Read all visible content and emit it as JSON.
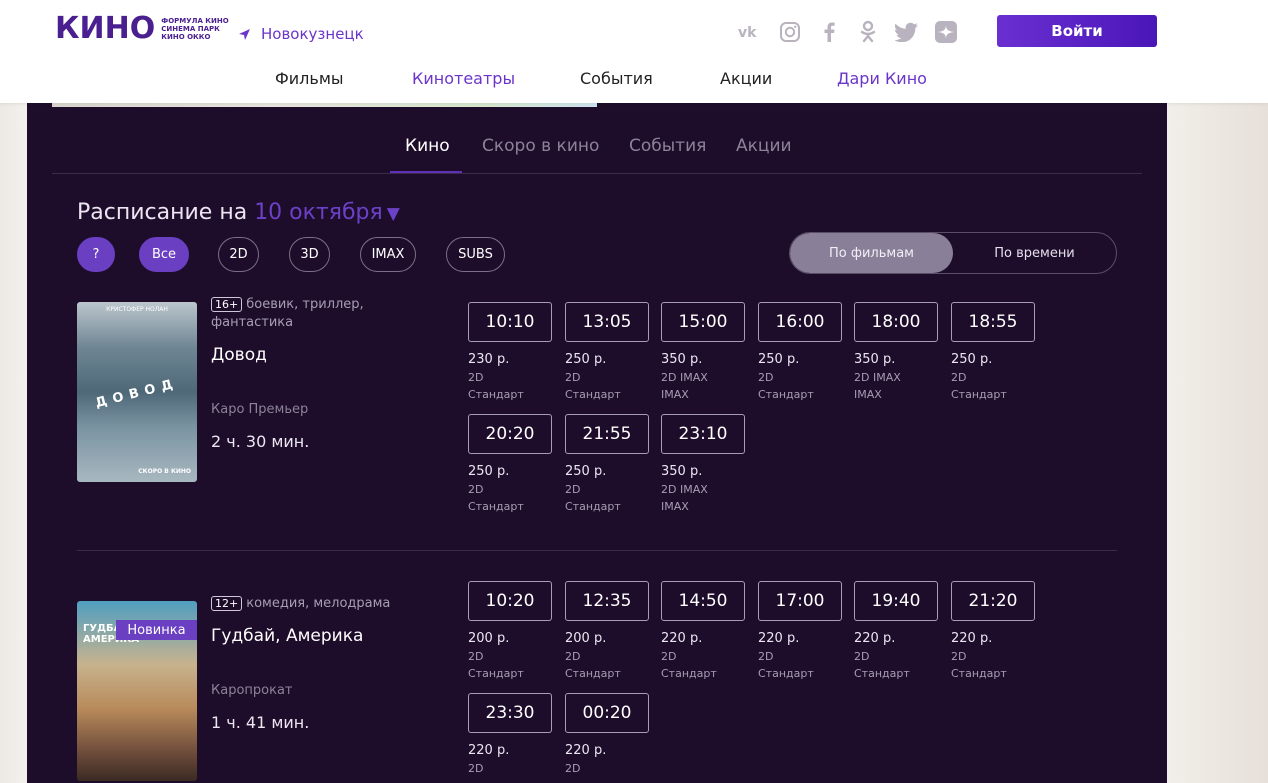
{
  "header": {
    "logo_text": "КИНО",
    "logo_sub": [
      "ФОРМУЛА КИНО",
      "СИНЕМА ПАРК",
      "КИНО ОККО"
    ],
    "city": "Новокузнецк",
    "login_label": "Войти",
    "socials": [
      "vk-icon",
      "instagram-icon",
      "facebook-icon",
      "odnoklassniki-icon",
      "twitter-icon",
      "zen-icon"
    ],
    "nav": [
      "Фильмы",
      "Кинотеатры",
      "События",
      "Акции",
      "Дари Кино"
    ]
  },
  "tabs": [
    "Кино",
    "Скоро в кино",
    "События",
    "Акции"
  ],
  "schedule": {
    "title_prefix": "Расписание на",
    "date": "10 октября",
    "filters": [
      "?",
      "Все",
      "2D",
      "3D",
      "IMAX",
      "SUBS"
    ],
    "view_toggle": [
      "По фильмам",
      "По времени"
    ]
  },
  "movies": [
    {
      "age": "16+",
      "genres": "боевик, триллер, фантастика",
      "title": "Довод",
      "distributor": "Каро Премьер",
      "duration": "2 ч. 30 мин.",
      "poster_top": "КРИСТОФЕР НОЛАН",
      "poster_title": "ДОВОД",
      "poster_bottom": "СКОРО В КИНО",
      "sessions": [
        {
          "time": "10:10",
          "price": "230 р.",
          "format": "2D",
          "hall": "Стандарт"
        },
        {
          "time": "13:05",
          "price": "250 р.",
          "format": "2D",
          "hall": "Стандарт"
        },
        {
          "time": "15:00",
          "price": "350 р.",
          "format": "2D IMAX",
          "hall": "IMAX"
        },
        {
          "time": "16:00",
          "price": "250 р.",
          "format": "2D",
          "hall": "Стандарт"
        },
        {
          "time": "18:00",
          "price": "350 р.",
          "format": "2D IMAX",
          "hall": "IMAX"
        },
        {
          "time": "18:55",
          "price": "250 р.",
          "format": "2D",
          "hall": "Стандарт"
        },
        {
          "time": "20:20",
          "price": "250 р.",
          "format": "2D",
          "hall": "Стандарт"
        },
        {
          "time": "21:55",
          "price": "250 р.",
          "format": "2D",
          "hall": "Стандарт"
        },
        {
          "time": "23:10",
          "price": "350 р.",
          "format": "2D IMAX",
          "hall": "IMAX"
        }
      ]
    },
    {
      "age": "12+",
      "genres": "комедия, мелодрама",
      "title": "Гудбай, Америка",
      "distributor": "Каропрокат",
      "duration": "1 ч. 41 мин.",
      "badge": "Новинка",
      "poster_title": "ГУДБАЙ, АМЕРИКА",
      "sessions": [
        {
          "time": "10:20",
          "price": "200 р.",
          "format": "2D",
          "hall": "Стандарт"
        },
        {
          "time": "12:35",
          "price": "200 р.",
          "format": "2D",
          "hall": "Стандарт"
        },
        {
          "time": "14:50",
          "price": "220 р.",
          "format": "2D",
          "hall": "Стандарт"
        },
        {
          "time": "17:00",
          "price": "220 р.",
          "format": "2D",
          "hall": "Стандарт"
        },
        {
          "time": "19:40",
          "price": "220 р.",
          "format": "2D",
          "hall": "Стандарт"
        },
        {
          "time": "21:20",
          "price": "220 р.",
          "format": "2D",
          "hall": "Стандарт"
        },
        {
          "time": "23:30",
          "price": "220 р.",
          "format": "2D",
          "hall": ""
        },
        {
          "time": "00:20",
          "price": "220 р.",
          "format": "2D",
          "hall": ""
        }
      ]
    }
  ],
  "colors": {
    "accent": "#6b35c9",
    "panel_bg": "#1d0d2a",
    "button_bg": "#5a1fc7"
  }
}
